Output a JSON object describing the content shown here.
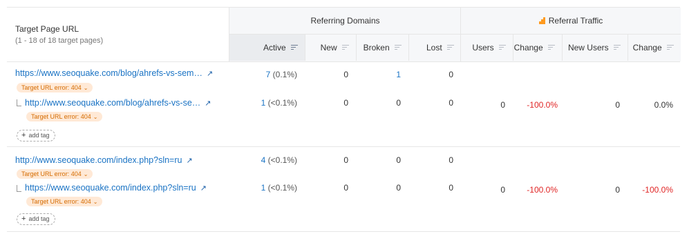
{
  "header": {
    "target_label": "Target Page URL",
    "target_sub": "(1 - 18 of 18 target pages)",
    "referring_domains": "Referring Domains",
    "referral_traffic": "Referral Traffic",
    "cols": {
      "active": "Active",
      "new": "New",
      "broken": "Broken",
      "lost": "Lost",
      "users": "Users",
      "change": "Change",
      "new_users": "New Users",
      "change2": "Change"
    }
  },
  "rows": [
    {
      "main_url": "https://www.seoquake.com/blog/ahrefs-vs-sem…",
      "main_badge": "Target URL error: 404",
      "main_active": "7",
      "main_active_pct": "(0.1%)",
      "main_new": "0",
      "main_broken": "1",
      "main_lost": "0",
      "sub_url": "http://www.seoquake.com/blog/ahrefs-vs-se…",
      "sub_badge": "Target URL error: 404",
      "sub_active": "1",
      "sub_active_pct": "(<0.1%)",
      "sub_new": "0",
      "sub_broken": "0",
      "sub_lost": "0",
      "users": "0",
      "change": "-100.0%",
      "new_users": "0",
      "change2": "0.0%",
      "add_tag": "add tag"
    },
    {
      "main_url": "http://www.seoquake.com/index.php?sln=ru",
      "main_badge": "Target URL error: 404",
      "main_active": "4",
      "main_active_pct": "(<0.1%)",
      "main_new": "0",
      "main_broken": "0",
      "main_lost": "0",
      "sub_url": "https://www.seoquake.com/index.php?sln=ru",
      "sub_badge": "Target URL error: 404",
      "sub_active": "1",
      "sub_active_pct": "(<0.1%)",
      "sub_new": "0",
      "sub_broken": "0",
      "sub_lost": "0",
      "users": "0",
      "change": "-100.0%",
      "new_users": "0",
      "change2": "-100.0%",
      "add_tag": "add tag"
    }
  ],
  "colors": {
    "link": "#1a73c4",
    "negative": "#e02424",
    "badge_bg": "#ffe9d6",
    "badge_text": "#d46b00",
    "accent": "#ff9a1f"
  }
}
